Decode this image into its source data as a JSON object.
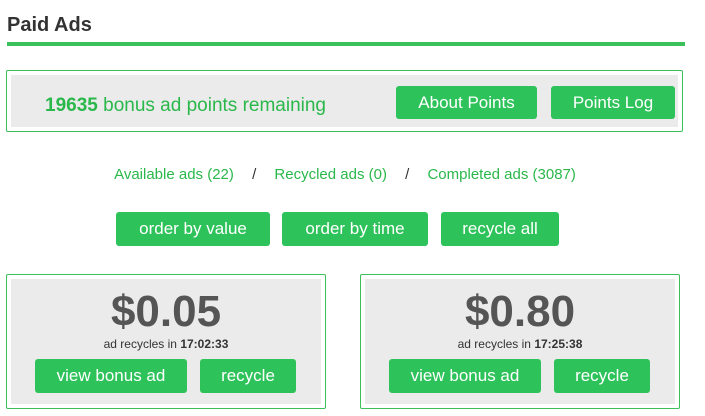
{
  "page_title": "Paid Ads",
  "points": {
    "count": "19635",
    "label": "bonus ad points remaining",
    "about_label": "About Points",
    "log_label": "Points Log"
  },
  "filters": {
    "available": "Available ads (22)",
    "recycled": "Recycled ads (0)",
    "completed": "Completed ads (3087)",
    "separator": "/"
  },
  "order": {
    "by_value": "order by value",
    "by_time": "order by time",
    "recycle_all": "recycle all"
  },
  "ads": [
    {
      "price": "$0.05",
      "recycle_prefix": "ad recycles in",
      "recycle_time": "17:02:33",
      "view_label": "view bonus ad",
      "recycle_label": "recycle"
    },
    {
      "price": "$0.80",
      "recycle_prefix": "ad recycles in",
      "recycle_time": "17:25:38",
      "view_label": "view bonus ad",
      "recycle_label": "recycle"
    }
  ],
  "colors": {
    "accent": "#2ec25a",
    "border": "#3cc05a",
    "panel": "#ebebeb"
  }
}
